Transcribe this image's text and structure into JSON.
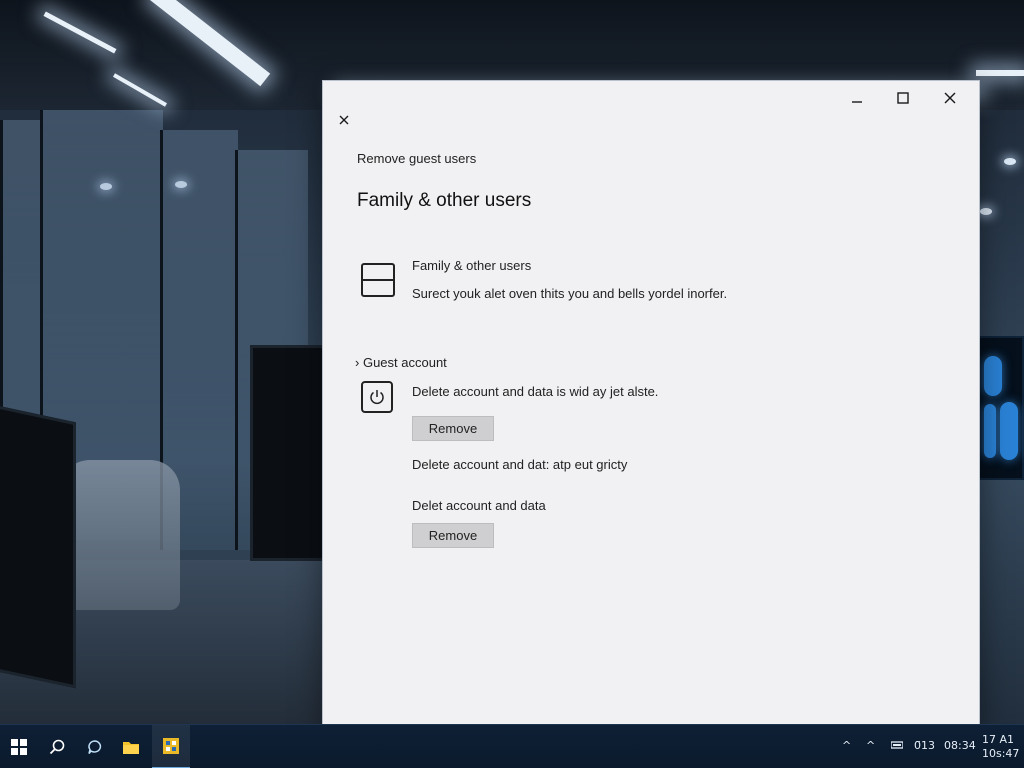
{
  "window": {
    "breadcrumb": "Remove guest users",
    "title": "Family & other users",
    "controls": {
      "minimize": "minimize-icon",
      "maximize": "maximize-icon",
      "close": "close-icon",
      "back": "close-icon"
    }
  },
  "family_row": {
    "title": "Family & other users",
    "subtitle": "Surect youk alet oven thits you and bells yordel inorfer."
  },
  "guest_section": {
    "header": "Guest account",
    "items": [
      {
        "description": "Delete account and data is wid ay jet alste.",
        "button": "Remove"
      },
      {
        "description": "Delete account and dat: atp eut gricty"
      },
      {
        "description": "Delet account and data",
        "button": "Remove"
      }
    ]
  },
  "taskbar": {
    "icons": [
      "windows-start-icon",
      "search-icon",
      "chat-icon",
      "file-explorer-icon",
      "settings-app-icon"
    ],
    "tray": {
      "chevrons": [
        "^",
        "^"
      ],
      "text_a": "0̈13",
      "text_b": "08:34",
      "clock_line1": "17 A1",
      "clock_line2": "10s:47"
    }
  },
  "colors": {
    "window_bg": "#f1f0f3",
    "button_bg": "#cfcfd1",
    "taskbar_bg": "#0e2036"
  }
}
